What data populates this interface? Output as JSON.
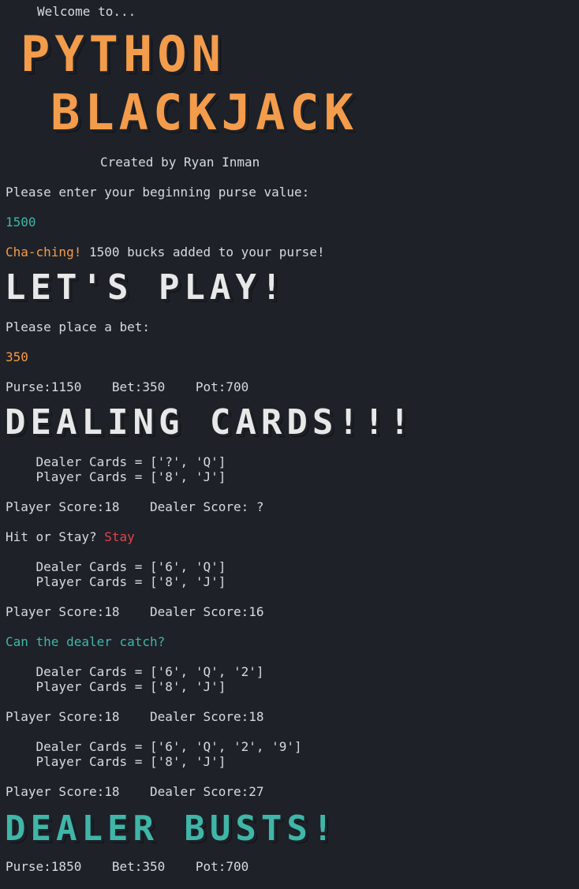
{
  "intro": {
    "welcome": "Welcome to...",
    "title_line1": "PYTHON",
    "title_line2": "BLACKJACK",
    "credit": "Created by Ryan Inman"
  },
  "purse_prompt": "Please enter your beginning purse value:",
  "purse_input": "1500",
  "chaching": {
    "label": "Cha-ching!",
    "message": " 1500 bucks added to your purse!"
  },
  "lets_play": "LET'S PLAY!",
  "bet_prompt": "Please place a bet:",
  "bet_input": "350",
  "status1": "Purse:1150    Bet:350    Pot:700",
  "dealing": "DEALING CARDS!!!",
  "round1": {
    "dealer": "    Dealer Cards = ['?', 'Q']",
    "player": "    Player Cards = ['8', 'J']",
    "score": "Player Score:18    Dealer Score: ?"
  },
  "hit_stay": {
    "question": "Hit or Stay? ",
    "answer": "Stay"
  },
  "round2": {
    "dealer": "    Dealer Cards = ['6', 'Q']",
    "player": "    Player Cards = ['8', 'J']",
    "score": "Player Score:18    Dealer Score:16"
  },
  "catch_prompt": "Can the dealer catch?",
  "round3": {
    "dealer": "    Dealer Cards = ['6', 'Q', '2']",
    "player": "    Player Cards = ['8', 'J']",
    "score": "Player Score:18    Dealer Score:18"
  },
  "round4": {
    "dealer": "    Dealer Cards = ['6', 'Q', '2', '9']",
    "player": "    Player Cards = ['8', 'J']",
    "score": "Player Score:18    Dealer Score:27"
  },
  "dealer_busts": "DEALER BUSTS!",
  "status2": "Purse:1850    Bet:350    Pot:700",
  "colors": {
    "background": "#1e2128",
    "text": "#d7dae0",
    "orange": "#f39c4b",
    "teal": "#3fb6a8",
    "red": "#e2434b"
  }
}
